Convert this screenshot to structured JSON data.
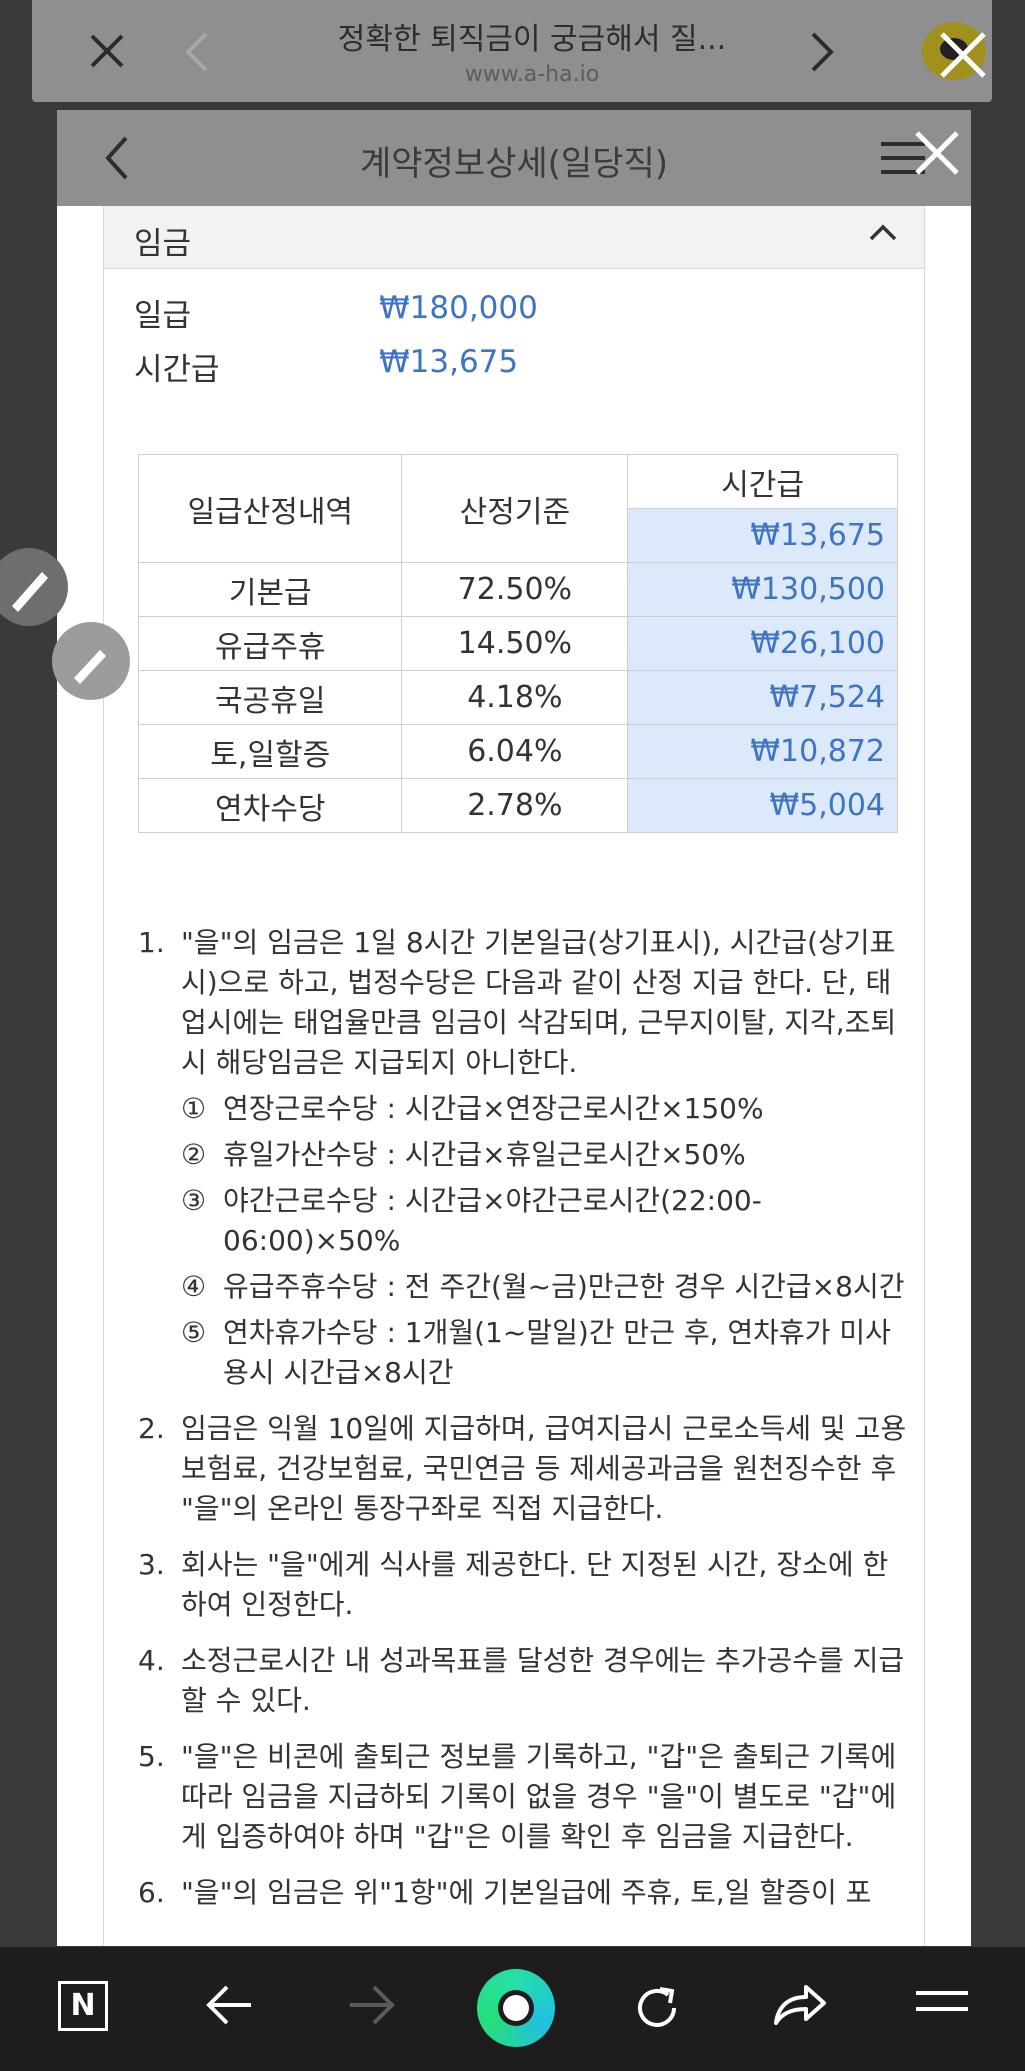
{
  "outer_bar": {
    "title": "정확한 퇴직금이 궁금해서 질...",
    "url": "www.a-ha.io"
  },
  "inner_bar": {
    "title": "계약정보상세(일당직)"
  },
  "section": {
    "title": "임금",
    "daily_label": "일급",
    "daily_value": "₩180,000",
    "hourly_label": "시간급",
    "hourly_value": "₩13,675"
  },
  "table": {
    "header_col1": "일급산정내역",
    "header_col2": "산정기준",
    "header_col3": "시간급",
    "header_col3_value": "₩13,675",
    "rows": [
      {
        "name": "기본급",
        "rate": "72.50%",
        "amount": "₩130,500"
      },
      {
        "name": "유급주휴",
        "rate": "14.50%",
        "amount": "₩26,100"
      },
      {
        "name": "국공휴일",
        "rate": "4.18%",
        "amount": "₩7,524"
      },
      {
        "name": "토,일할증",
        "rate": "6.04%",
        "amount": "₩10,872"
      },
      {
        "name": "연차수당",
        "rate": "2.78%",
        "amount": "₩5,004"
      }
    ]
  },
  "notes": [
    {
      "num": "1.",
      "text": "\"을\"의 임금은 1일 8시간 기본일급(상기표시), 시간급(상기표시)으로 하고, 법정수당은 다음과 같이 산정 지급 한다. 단, 태업시에는 태업율만큼 임금이 삭감되며, 근무지이탈, 지각,조퇴시 해당임금은 지급되지 아니한다."
    },
    {
      "num": "2.",
      "text": "임금은 익월 10일에 지급하며, 급여지급시 근로소득세 및 고용보험료, 건강보험료, 국민연금 등 제세공과금을 원천징수한 후 \"을\"의 온라인 통장구좌로 직접 지급한다."
    },
    {
      "num": "3.",
      "text": "회사는 \"을\"에게 식사를 제공한다. 단 지정된 시간, 장소에 한하여 인정한다."
    },
    {
      "num": "4.",
      "text": "소정근로시간 내 성과목표를 달성한 경우에는 추가공수를 지급할 수 있다."
    },
    {
      "num": "5.",
      "text": "\"을\"은 비콘에 출퇴근 정보를 기록하고, \"갑\"은 출퇴근 기록에 따라 임금을 지급하되 기록이 없을 경우 \"을\"이 별도로 \"갑\"에게 입증하여야 하며 \"갑\"은 이를 확인 후 임금을 지급한다."
    },
    {
      "num": "6.",
      "text": "\"을\"의 임금은 위\"1항\"에 기본일급에 주휴, 토,일 할증이 포"
    }
  ],
  "subnotes": [
    {
      "c": "①",
      "text": "연장근로수당 : 시간급×연장근로시간×150%"
    },
    {
      "c": "②",
      "text": "휴일가산수당 : 시간급×휴일근로시간×50%"
    },
    {
      "c": "③",
      "text": "야간근로수당 : 시간급×야간근로시간(22:00-06:00)×50%"
    },
    {
      "c": "④",
      "text": "유급주휴수당 : 전 주간(월~금)만근한 경우 시간급×8시간"
    },
    {
      "c": "⑤",
      "text": "연차휴가수당 : 1개월(1~말일)간 만근 후, 연차휴가 미사용시 시간급×8시간"
    }
  ],
  "bottom_bar": {
    "n_label": "N"
  }
}
